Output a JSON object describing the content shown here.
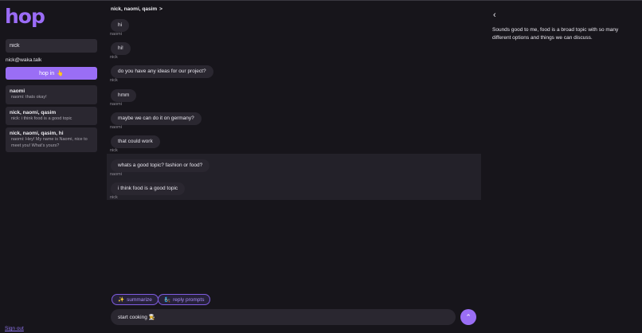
{
  "sidebar": {
    "logo": "hop",
    "search_value": "nick",
    "user_email": "nick@waka.talk",
    "hop_button_label": "hop in",
    "hop_button_icon": "👆",
    "conversations": [
      {
        "title": "naomi",
        "preview": "naomi: thats okay!"
      },
      {
        "title": "nick, naomi, qasim",
        "preview": "nick: i think food is a good topic"
      },
      {
        "title": "nick, naomi, qasim, hi",
        "preview": "naomi: Hey! My name is Naomi, nice to meet you! What's yours?"
      }
    ],
    "sign_out_label": "Sign out"
  },
  "chat": {
    "title": "nick, naomi, qasim",
    "title_chevron": ">",
    "messages": [
      {
        "text": "hi",
        "sender": "naomi"
      },
      {
        "text": "hi!",
        "sender": "nick"
      },
      {
        "text": "do you have any ideas for our project?",
        "sender": "nick"
      },
      {
        "text": "hmm",
        "sender": "naomi"
      },
      {
        "text": "maybe we can do it on germany?",
        "sender": "naomi"
      },
      {
        "text": "that could work",
        "sender": "nick"
      },
      {
        "text": "whats a good topic? fashion or food?",
        "sender": "naomi"
      },
      {
        "text": "i think food is a good topic",
        "sender": "nick"
      }
    ],
    "summarize_icon": "✨",
    "summarize_label": "summarize",
    "reply_prompts_icon": "🧞",
    "reply_prompts_label": "reply prompts",
    "composer_value": "start cooking 👨‍🍳",
    "send_icon": "⌃"
  },
  "panel": {
    "back_icon": "‹",
    "text": "Sounds good to me, food is a broad topic with so many different options and things we can discuss."
  },
  "colors": {
    "accent": "#9a6ef5",
    "background": "#17151b",
    "bubble": "#2a2730"
  }
}
